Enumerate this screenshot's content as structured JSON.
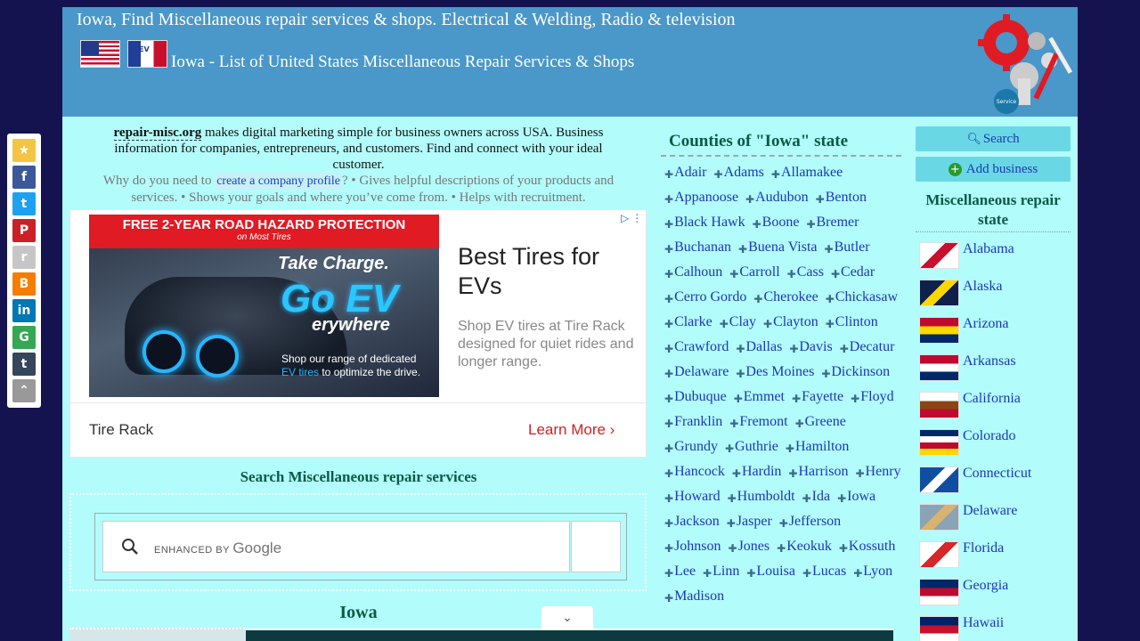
{
  "header": {
    "title": "Iowa, Find Miscellaneous repair services & shops. Electrical & Welding, Radio & television",
    "subtitle": "Iowa - List of United States Miscellaneous Repair Services & Shops"
  },
  "intro": {
    "brand": "repair-misc.org",
    "text": " makes digital marketing simple for business owners across USA. Business information for companies, entrepreneurs, and customers. Find and connect with your ideal customer.",
    "why_prefix": "Why do you need to ",
    "why_link": "create a company profile",
    "why_suffix": "? • Gives helpful descriptions of your products and services. • Shows your goals and where you’ve come from. • Helps with recruitment."
  },
  "ad": {
    "banner_title": "FREE 2-YEAR ROAD HAZARD PROTECTION",
    "banner_sub": "on Most Tires",
    "take_charge": "Take Charge.",
    "go_ev": "Go EV",
    "erywhere": "erywhere",
    "small_text_1": "Shop our range of dedicated ",
    "small_text_hl": "EV tires",
    "small_text_2": " to optimize the drive.",
    "headline": "Best Tires for EVs",
    "description": "Shop EV tires at Tire Rack designed for quiet rides and longer range.",
    "brand": "Tire Rack",
    "cta": "Learn More ›"
  },
  "search": {
    "title": "Search Miscellaneous repair services",
    "enhanced": "ENHANCED BY",
    "google": "Google"
  },
  "iowa_title": "Iowa",
  "counties": {
    "title": "Counties of \"Iowa\" state",
    "items": [
      "Adair",
      "Adams",
      "Allamakee",
      "Appanoose",
      "Audubon",
      "Benton",
      "Black Hawk",
      "Boone",
      "Bremer",
      "Buchanan",
      "Buena Vista",
      "Butler",
      "Calhoun",
      "Carroll",
      "Cass",
      "Cedar",
      "Cerro Gordo",
      "Cherokee",
      "Chickasaw",
      "Clarke",
      "Clay",
      "Clayton",
      "Clinton",
      "Crawford",
      "Dallas",
      "Davis",
      "Decatur",
      "Delaware",
      "Des Moines",
      "Dickinson",
      "Dubuque",
      "Emmet",
      "Fayette",
      "Floyd",
      "Franklin",
      "Fremont",
      "Greene",
      "Grundy",
      "Guthrie",
      "Hamilton",
      "Hancock",
      "Hardin",
      "Harrison",
      "Henry",
      "Howard",
      "Humboldt",
      "Ida",
      "Iowa",
      "Jackson",
      "Jasper",
      "Jefferson",
      "Johnson",
      "Jones",
      "Keokuk",
      "Kossuth",
      "Lee",
      "Linn",
      "Louisa",
      "Lucas",
      "Lyon",
      "Madison"
    ]
  },
  "sidebar": {
    "search_label": "Search",
    "add_business_label": "Add business",
    "states_title": "Miscellaneous repair state",
    "states": [
      {
        "name": "Alabama",
        "flag_colors": [
          "#ffffff",
          "#c8102e"
        ]
      },
      {
        "name": "Alaska",
        "flag_colors": [
          "#0f204b",
          "#ffd700"
        ]
      },
      {
        "name": "Arizona",
        "flag_colors": [
          "#bf0a30",
          "#ffd700",
          "#002868"
        ]
      },
      {
        "name": "Arkansas",
        "flag_colors": [
          "#bf0a30",
          "#ffffff",
          "#002868"
        ]
      },
      {
        "name": "California",
        "flag_colors": [
          "#ffffff",
          "#8b4513",
          "#bf0a30"
        ]
      },
      {
        "name": "Colorado",
        "flag_colors": [
          "#002868",
          "#ffffff",
          "#bf0a30",
          "#ffd700"
        ]
      },
      {
        "name": "Connecticut",
        "flag_colors": [
          "#0f4ea0",
          "#ffffff"
        ]
      },
      {
        "name": "Delaware",
        "flag_colors": [
          "#8aa3b5",
          "#d8b26e"
        ]
      },
      {
        "name": "Florida",
        "flag_colors": [
          "#ffffff",
          "#d62828"
        ]
      },
      {
        "name": "Georgia",
        "flag_colors": [
          "#002868",
          "#bf0a30",
          "#ffffff"
        ]
      },
      {
        "name": "Hawaii",
        "flag_colors": [
          "#012169",
          "#c8102e",
          "#ffffff"
        ]
      }
    ]
  },
  "share_bar": [
    "favorites",
    "facebook",
    "twitter",
    "pinterest",
    "reddit",
    "blogger",
    "linkedin",
    "google",
    "tumblr",
    "scroll-up"
  ]
}
